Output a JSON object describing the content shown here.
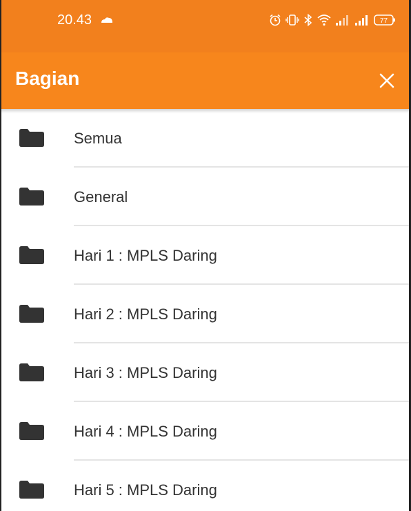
{
  "status_bar": {
    "time": "20.43",
    "battery": "77"
  },
  "app_bar": {
    "title": "Bagian",
    "close_icon": "close-icon"
  },
  "colors": {
    "status_bar": "#f2801d",
    "app_bar": "#f7861c",
    "folder_icon": "#333333"
  },
  "sections": [
    {
      "label": "Semua",
      "icon": "folder-icon"
    },
    {
      "label": "General",
      "icon": "folder-icon"
    },
    {
      "label": "Hari 1 : MPLS Daring",
      "icon": "folder-icon"
    },
    {
      "label": "Hari 2 : MPLS Daring",
      "icon": "folder-icon"
    },
    {
      "label": "Hari 3 : MPLS Daring",
      "icon": "folder-icon"
    },
    {
      "label": "Hari 4 : MPLS Daring",
      "icon": "folder-icon"
    },
    {
      "label": "Hari 5 : MPLS Daring",
      "icon": "folder-icon"
    }
  ]
}
